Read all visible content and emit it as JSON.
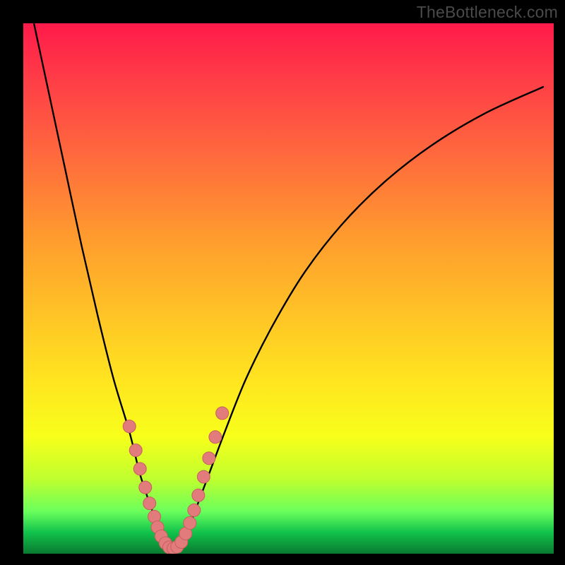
{
  "attribution": "TheBottleneck.com",
  "colors": {
    "background": "#000000",
    "gradient_top": "#ff1a4a",
    "gradient_mid1": "#ff9a2e",
    "gradient_mid2": "#ffe61f",
    "gradient_bottom": "#0a7a30",
    "curve": "#000000",
    "marker_fill": "#e27b7b",
    "marker_stroke": "#c95e5e"
  },
  "chart_data": {
    "type": "line",
    "title": "",
    "xlabel": "",
    "ylabel": "",
    "xlim": [
      0,
      100
    ],
    "ylim": [
      0,
      100
    ],
    "series": [
      {
        "name": "bottleneck-curve",
        "x": [
          2,
          5,
          8,
          11,
          14,
          17,
          20,
          22,
          24,
          25.5,
          27,
          28.5,
          30,
          31,
          32,
          35,
          38,
          42,
          47,
          53,
          60,
          68,
          77,
          87,
          98
        ],
        "y": [
          100,
          86,
          72,
          58,
          45,
          33,
          23,
          15,
          9,
          5,
          2,
          1,
          2,
          4,
          7,
          15,
          23,
          33,
          43,
          53,
          62,
          70,
          77,
          83,
          88
        ]
      }
    ],
    "markers": {
      "name": "highlighted-points",
      "x": [
        20.0,
        21.2,
        22.0,
        23.0,
        23.8,
        24.7,
        25.3,
        26.0,
        26.8,
        27.5,
        28.3,
        29.0,
        29.8,
        30.6,
        31.4,
        32.2,
        33.0,
        34.0,
        35.0,
        36.2,
        37.5
      ],
      "y": [
        24.0,
        19.5,
        16.0,
        12.5,
        9.5,
        7.0,
        5.0,
        3.3,
        2.0,
        1.2,
        1.0,
        1.3,
        2.2,
        3.8,
        5.8,
        8.2,
        11.0,
        14.5,
        18.0,
        22.0,
        26.5
      ]
    }
  }
}
